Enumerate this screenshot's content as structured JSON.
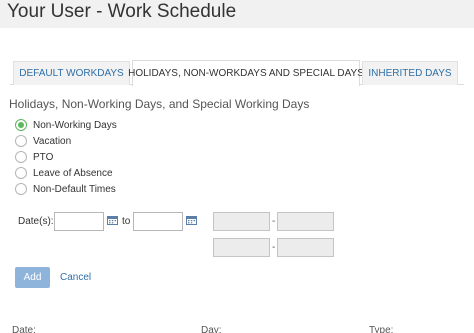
{
  "page": {
    "title": "Your User - Work Schedule"
  },
  "tabs": [
    {
      "label": "DEFAULT WORKDAYS",
      "active": false
    },
    {
      "label": "HOLIDAYS, NON-WORKDAYS AND SPECIAL DAYS",
      "active": true
    },
    {
      "label": "INHERITED DAYS",
      "active": false
    }
  ],
  "section": {
    "heading": "Holidays, Non-Working Days, and Special Working Days"
  },
  "day_types": {
    "selected": "Non-Working Days",
    "options": [
      {
        "label": "Non-Working Days",
        "checked": true
      },
      {
        "label": "Vacation",
        "checked": false
      },
      {
        "label": "PTO",
        "checked": false
      },
      {
        "label": "Leave of Absence",
        "checked": false
      },
      {
        "label": "Non-Default Times",
        "checked": false
      }
    ]
  },
  "dates": {
    "label": "Date(s):",
    "to_label": "to",
    "start_value": "",
    "end_value": "",
    "time_separator": "-"
  },
  "actions": {
    "add_label": "Add",
    "cancel_label": "Cancel"
  },
  "table": {
    "columns": [
      "Date:",
      "Day:",
      "Type:"
    ]
  },
  "colors": {
    "accent_green": "#5cb85c",
    "link_blue": "#2f6fa8",
    "add_button": "#8fb4dc"
  }
}
